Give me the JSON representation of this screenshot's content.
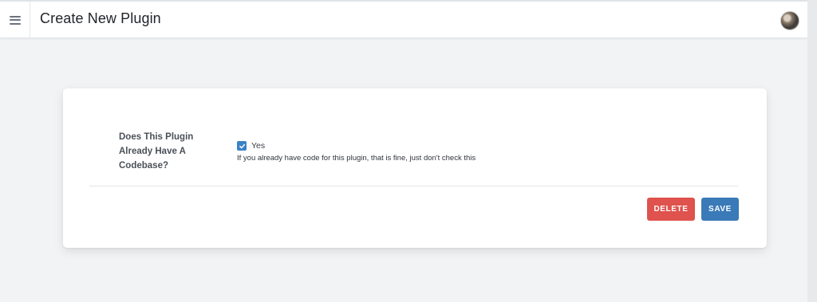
{
  "header": {
    "title": "Create New Plugin",
    "menu_icon": "hamburger-menu-icon",
    "avatar_icon": "user-avatar"
  },
  "form": {
    "codebase_field": {
      "label": "Does This Plugin Already Have A Codebase?",
      "checkbox_label": "Yes",
      "checked": true,
      "help_text": "If you already have code for this plugin, that is fine, just don't check this"
    }
  },
  "actions": {
    "delete_label": "DELETE",
    "save_label": "SAVE"
  },
  "colors": {
    "delete": "#df524d",
    "save": "#3a7ab8",
    "checkbox": "#3b82c4",
    "background": "#f2f3f5"
  }
}
